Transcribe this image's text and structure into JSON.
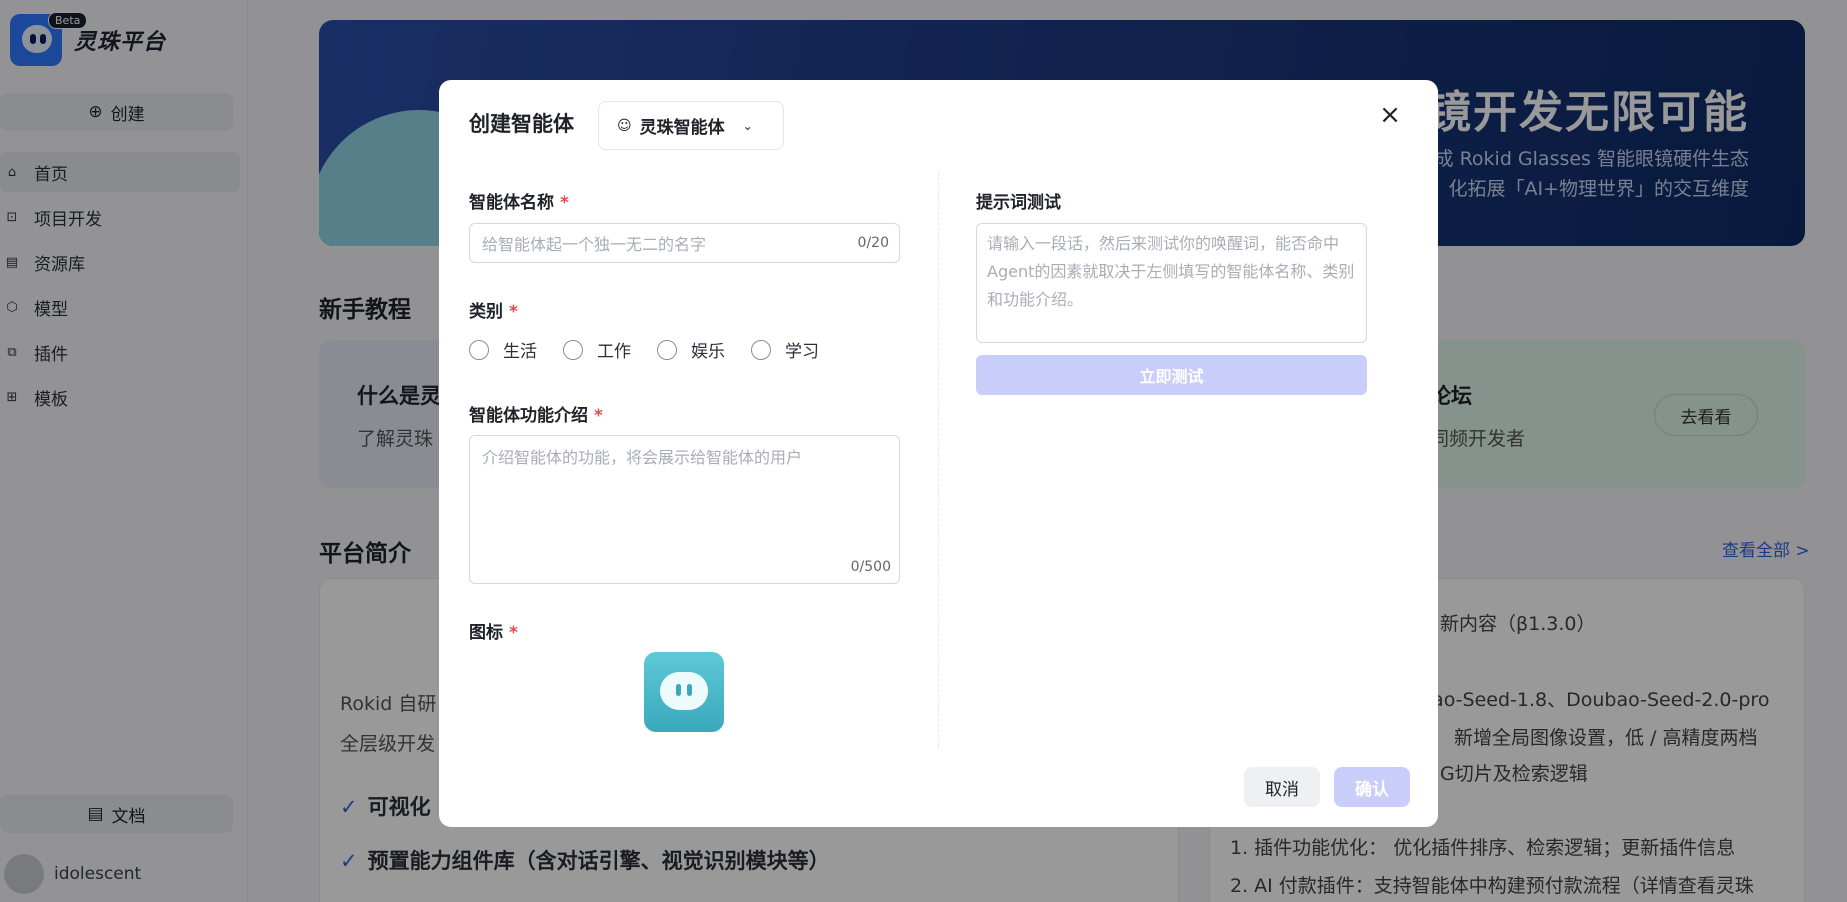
{
  "brand": {
    "name": "灵珠平台",
    "badge": "Beta"
  },
  "sidebar": {
    "create_label": "创建",
    "items": [
      {
        "label": "首页",
        "icon": "home-icon"
      },
      {
        "label": "项目开发",
        "icon": "project-icon"
      },
      {
        "label": "资源库",
        "icon": "library-icon"
      },
      {
        "label": "模型",
        "icon": "model-icon"
      },
      {
        "label": "插件",
        "icon": "plugin-icon"
      },
      {
        "label": "模板",
        "icon": "template-icon"
      }
    ],
    "docs_label": "文档",
    "username": "idolescent"
  },
  "banner": {
    "title": "镜开发无限可能",
    "sub1": "成 Rokid Glasses 智能眼镜硬件生态",
    "sub2": "化拓展「AI+物理世界」的交互维度"
  },
  "tutorial": {
    "section_title": "新手教程",
    "card_a_title": "什么是灵",
    "card_a_sub": "了解灵珠",
    "card_b_title": "论坛",
    "card_b_sub": "同频开发者",
    "card_b_button": "去看看"
  },
  "platform": {
    "section_title": "平台简介",
    "view_all": "查看全部 >",
    "intro_p1": "Rokid 自研",
    "intro_p2": "全层级开发",
    "check1": "可视化",
    "check2": "预置能力组件库（含对话引擎、视觉识别模块等）",
    "news": [
      "新内容（β1.3.0）",
      "bao-Seed-1.8、Doubao-Seed-2.0-pro",
      "新增全局图像设置，低 / 高精度两档",
      "G切片及检索逻辑",
      "1. 插件功能优化： 优化插件排序、检索逻辑；更新插件信息",
      "2. AI 付款插件：支持智能体中构建预付款流程（详情查看灵珠"
    ]
  },
  "modal": {
    "title": "创建智能体",
    "type_select": "灵珠智能体",
    "close_icon": "×",
    "name_label": "智能体名称",
    "name_placeholder": "给智能体起一个独一无二的名字",
    "name_count": "0/20",
    "category_label": "类别",
    "categories": [
      "生活",
      "工作",
      "娱乐",
      "学习"
    ],
    "desc_label": "智能体功能介绍",
    "desc_placeholder": "介绍智能体的功能，将会展示给智能体的用户",
    "desc_count": "0/500",
    "icon_label": "图标",
    "prompt_test_label": "提示词测试",
    "prompt_placeholder": "请输入一段话，然后来测试你的唤醒词，能否命中Agent的因素就取决于左侧填写的智能体名称、类别和功能介绍。",
    "test_button": "立即测试",
    "cancel_button": "取消",
    "confirm_button": "确认",
    "required_mark": "*"
  },
  "colors": {
    "accent": "#2f63e0",
    "disabled_button": "#c9cdfa",
    "required": "#e5484d"
  }
}
